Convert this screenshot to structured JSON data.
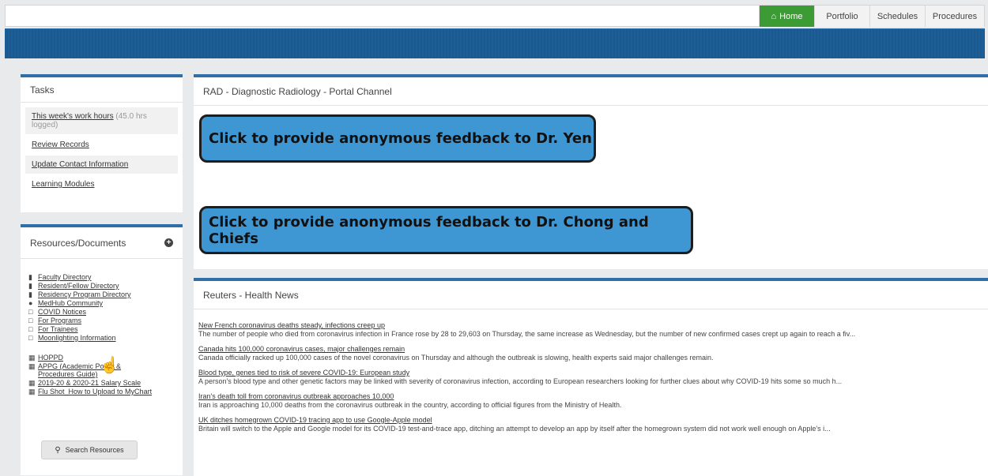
{
  "nav": {
    "tabs": [
      {
        "label": "Home",
        "active": true
      },
      {
        "label": "Portfolio"
      },
      {
        "label": "Schedules"
      },
      {
        "label": "Procedures"
      }
    ]
  },
  "colors": {
    "accent_blue": "#2f6fa6",
    "home_green": "#3d9b35",
    "feedback_blue": "#3e96d2"
  },
  "tasks": {
    "title": "Tasks",
    "items": [
      {
        "label": "This week's work hours",
        "note": "(45.0 hrs logged)"
      },
      {
        "label": "Review Records"
      },
      {
        "label": "Update Contact Information"
      },
      {
        "label": "Learning Modules"
      }
    ]
  },
  "resources": {
    "title": "Resources/Documents",
    "items": [
      {
        "icon": "book-icon",
        "label": "Faculty Directory"
      },
      {
        "icon": "book-icon",
        "label": "Resident/Fellow Directory"
      },
      {
        "icon": "book-icon",
        "label": "Residency Program Directory"
      },
      {
        "icon": "globe-icon",
        "label": "MedHub Community"
      },
      {
        "icon": "folder-icon",
        "label": "COVID Notices"
      },
      {
        "icon": "folder-icon",
        "label": "For Programs"
      },
      {
        "icon": "folder-icon",
        "label": "For Trainees"
      },
      {
        "icon": "folder-icon",
        "label": "Moonlighting Information"
      }
    ],
    "docs": [
      {
        "icon": "document-icon",
        "label": "HOPPD"
      },
      {
        "icon": "document-icon",
        "label": "APPG (Academic Policy & Procedures Guide)"
      },
      {
        "icon": "document-icon",
        "label": "2019-20 & 2020-21 Salary Scale"
      },
      {
        "icon": "document-icon",
        "label": "Flu Shot_How to Upload to MyChart"
      }
    ],
    "search_label": "Search Resources"
  },
  "channel": {
    "title": "RAD - Diagnostic Radiology - Portal Channel",
    "feedback1": "Click to provide anonymous feedback to Dr. Yen",
    "feedback2": "Click to provide anonymous feedback to Dr. Chong and Chiefs"
  },
  "news": {
    "title": "Reuters - Health News",
    "items": [
      {
        "title": "New French coronavirus deaths steady, infections creep up",
        "desc": "The number of people who died from coronavirus infection in France rose by 28 to 29,603 on Thursday, the same increase as Wednesday, but the number of new confirmed cases crept up again to reach a fiv..."
      },
      {
        "title": "Canada hits 100,000 coronavirus cases, major challenges remain",
        "desc": "Canada officially racked up 100,000 cases of the novel coronavirus on Thursday and although the outbreak is slowing, health experts said major challenges remain."
      },
      {
        "title": "Blood type, genes tied to risk of severe COVID-19: European study",
        "desc": "A person's blood type and other genetic factors may be linked with severity of coronavirus infection, according to European researchers looking for further clues about why COVID-19 hits some so much h..."
      },
      {
        "title": "Iran's death toll from coronavirus outbreak approaches 10,000",
        "desc": "Iran is approaching 10,000 deaths from the coronavirus outbreak in the country, according to official figures from the Ministry of Health."
      },
      {
        "title": "UK ditches homegrown COVID-19 tracing app to use Google-Apple model",
        "desc": "Britain will switch to the Apple and Google model for its COVID-19 test-and-trace app, ditching an attempt to develop an app by itself after the homegrown system did not work well enough on Apple's i..."
      }
    ]
  }
}
